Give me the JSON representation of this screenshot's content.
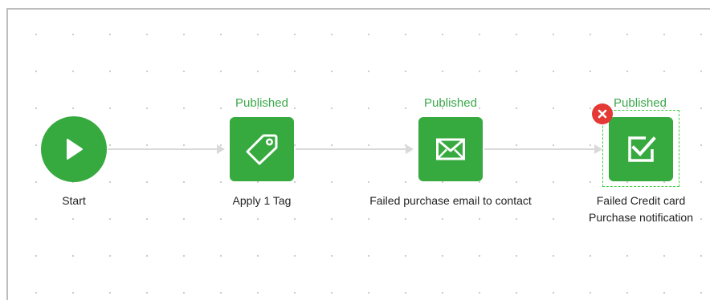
{
  "workflow": {
    "start": {
      "label": "Start",
      "icon": "play-icon"
    },
    "steps": [
      {
        "status": "Published",
        "label_lines": [
          "Apply 1 Tag"
        ],
        "icon": "tag-icon"
      },
      {
        "status": "Published",
        "label_lines": [
          "Failed purchase email to contact"
        ],
        "icon": "envelope-icon"
      },
      {
        "status": "Published",
        "label_lines": [
          "Failed Credit card",
          "Purchase notification"
        ],
        "icon": "task-checkbox-icon",
        "selected": true,
        "delete_icon": "close-icon"
      }
    ]
  },
  "colors": {
    "node_green": "#36a93f",
    "status_green": "#3aa84a",
    "connector_gray": "#d9d9d9",
    "selection_green": "#3fcf3f",
    "delete_red": "#e53935"
  }
}
